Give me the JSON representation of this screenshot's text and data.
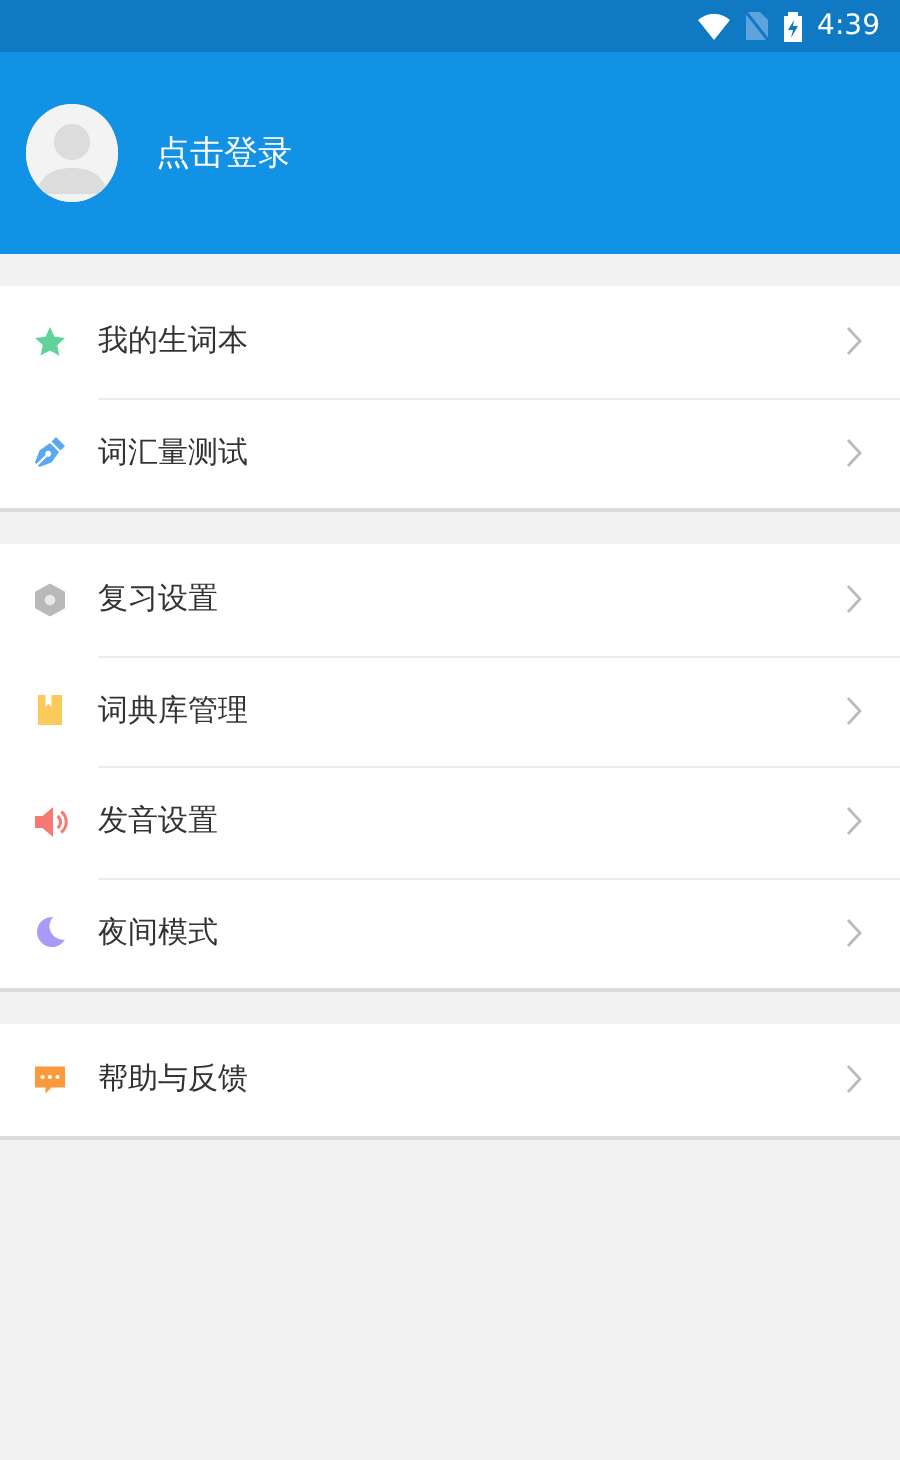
{
  "status_bar": {
    "time": "4:39"
  },
  "header": {
    "login_label": "点击登录"
  },
  "menu_groups": [
    {
      "items": [
        {
          "label": "我的生词本"
        },
        {
          "label": "词汇量测试"
        }
      ]
    },
    {
      "items": [
        {
          "label": "复习设置"
        },
        {
          "label": "词典库管理"
        },
        {
          "label": "发音设置"
        },
        {
          "label": "夜间模式"
        }
      ]
    },
    {
      "items": [
        {
          "label": "帮助与反馈"
        }
      ]
    }
  ]
}
